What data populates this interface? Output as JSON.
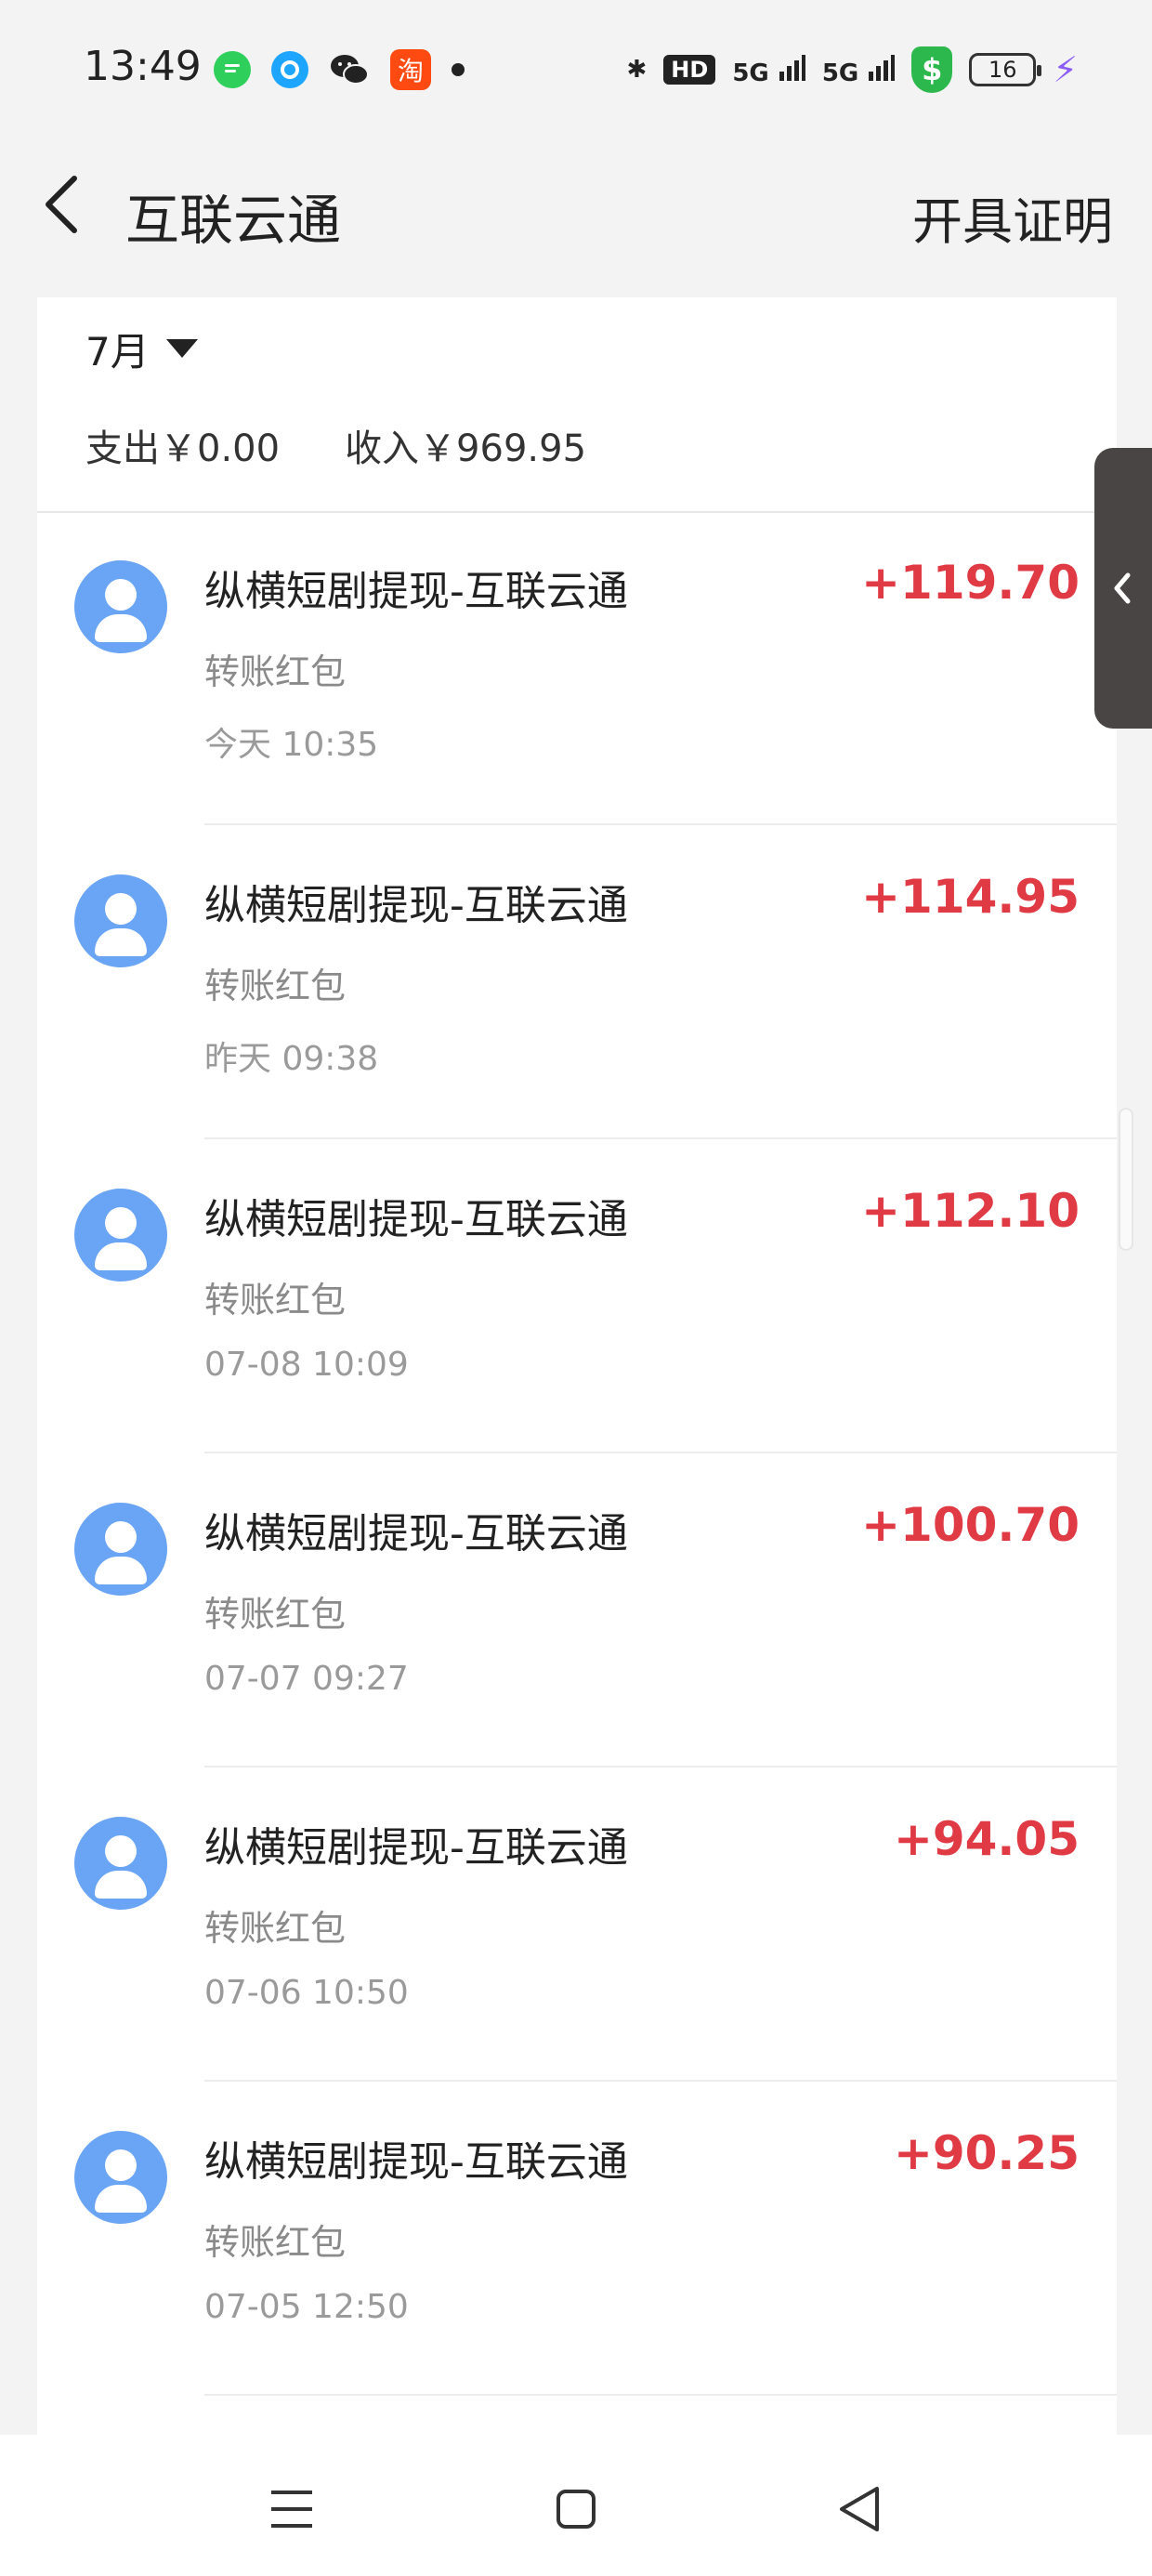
{
  "status_bar": {
    "time": "13:49",
    "apps": [
      "messages-icon",
      "browser-icon",
      "wechat-icon",
      "taobao-icon"
    ],
    "taobao_char": "淘",
    "bluetooth": "✱",
    "hd": "HD",
    "signal1": "5G",
    "signal2": "5G",
    "security_glyph": "$",
    "battery": "16"
  },
  "header": {
    "title": "互联云通",
    "action": "开具证明"
  },
  "filter": {
    "month": "7月"
  },
  "summary": {
    "expense": "支出￥0.00",
    "income": "收入￥969.95"
  },
  "transactions": [
    {
      "title": "纵横短剧提现-互联云通",
      "type": "转账红包",
      "time": "今天 10:35",
      "amount": "+119.70"
    },
    {
      "title": "纵横短剧提现-互联云通",
      "type": "转账红包",
      "time": "昨天 09:38",
      "amount": "+114.95"
    },
    {
      "title": "纵横短剧提现-互联云通",
      "type": "转账红包",
      "time": "07-08 10:09",
      "amount": "+112.10"
    },
    {
      "title": "纵横短剧提现-互联云通",
      "type": "转账红包",
      "time": "07-07 09:27",
      "amount": "+100.70"
    },
    {
      "title": "纵横短剧提现-互联云通",
      "type": "转账红包",
      "time": "07-06 10:50",
      "amount": "+94.05"
    },
    {
      "title": "纵横短剧提现-互联云通",
      "type": "转账红包",
      "time": "07-05 12:50",
      "amount": "+90.25"
    }
  ],
  "colors": {
    "amount_positive": "#e03a45",
    "avatar": "#6aa4f4",
    "background": "#f3f3f3"
  }
}
